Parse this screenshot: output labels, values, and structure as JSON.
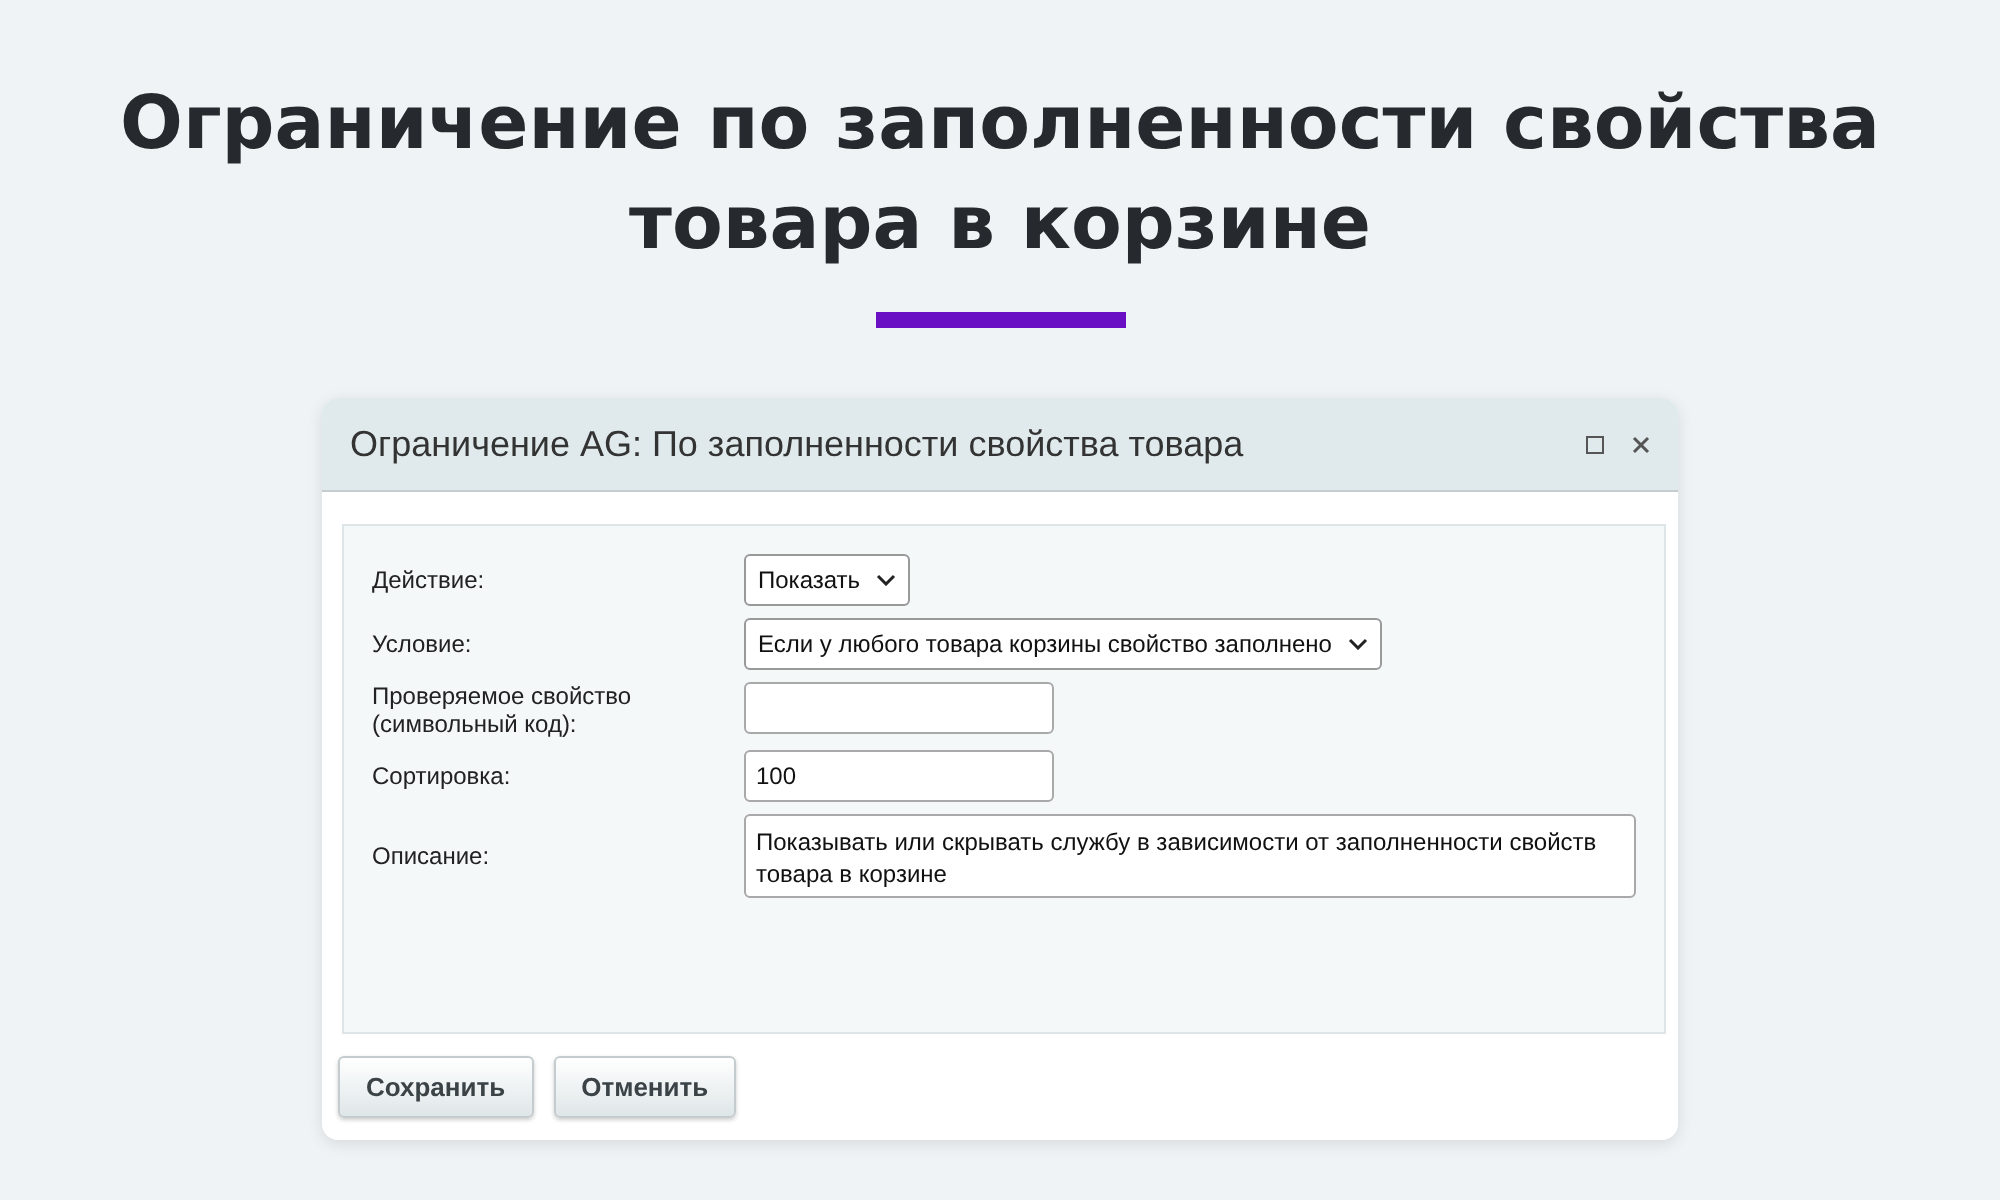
{
  "heading": "Ограничение по заполненности свойства товара в корзине",
  "dialog": {
    "title": "Ограничение AG: По заполненности свойства товара",
    "fields": [
      {
        "kind": "select",
        "label": "Действие:",
        "value": "Показать"
      },
      {
        "kind": "select",
        "label": "Условие:",
        "value": "Если у любого товара корзины свойство заполнено"
      },
      {
        "kind": "input",
        "label": "Проверяемое свойство (символьный код):"
      },
      {
        "kind": "input",
        "label": "Сортировка:",
        "value": "100"
      },
      {
        "kind": "textarea",
        "label": "Описание:",
        "value": "Показывать или скрывать службу в зависимости от заполненности свойств товара в корзине"
      }
    ],
    "buttons": [
      "Сохранить",
      "Отменить"
    ]
  }
}
